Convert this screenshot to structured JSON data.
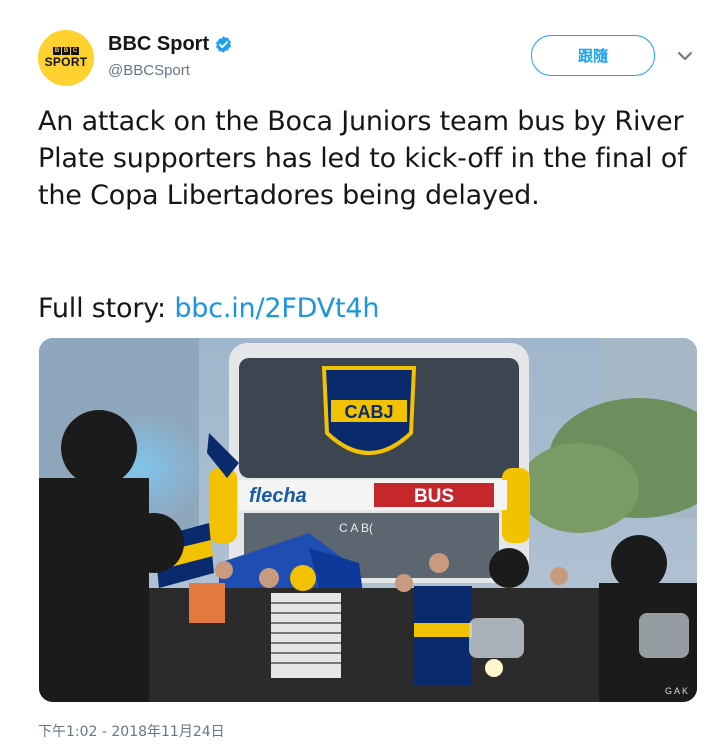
{
  "account": {
    "display_name": "BBC Sport",
    "handle": "@BBCSport",
    "avatar_letters": [
      "B",
      "B",
      "C"
    ],
    "avatar_word": "SPORT",
    "verified": true
  },
  "follow_button": {
    "label": "跟隨"
  },
  "tweet": {
    "text": "An attack on the Boca Juniors team bus by River Plate supporters has led to kick-off in the final of the Copa Libertadores being delayed.",
    "full_story_prefix": "Full story: ",
    "link_text": "bbc.in/2FDVt4h",
    "timestamp": "下午1:02 - 2018年11月24日"
  },
  "photo": {
    "bus_crest_text": "CABJ",
    "bus_brand_text_1": "flecha",
    "bus_brand_text_2": "BUS",
    "bus_plate_text": "C A B(",
    "watermark": "G A K"
  },
  "colors": {
    "avatar_bg": "#ffd230",
    "link": "#1b95e0",
    "follow_border": "#1da1f2",
    "secondary_text": "#657786",
    "boca_blue": "#0a2a6e",
    "boca_gold": "#f2c200"
  },
  "icons": {
    "verified": "verified-badge-icon",
    "caret": "chevron-down-icon"
  }
}
